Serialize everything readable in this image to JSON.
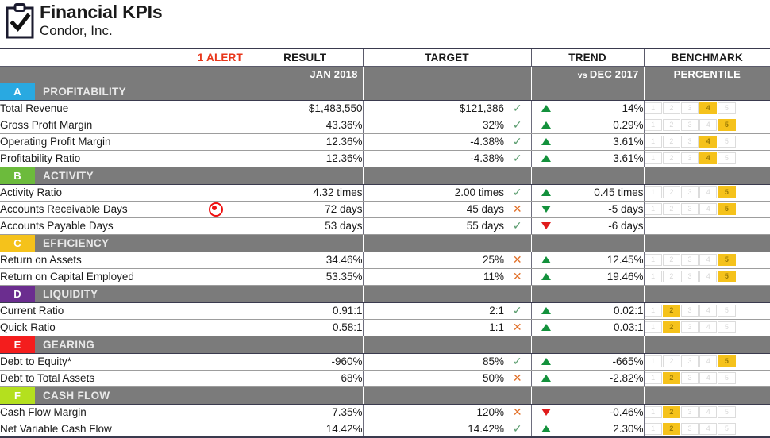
{
  "header": {
    "icon": "clipboard-check-icon",
    "title": "Financial KPIs",
    "subtitle": "Condor, Inc."
  },
  "columns": {
    "name": "",
    "alert": "1 ALERT",
    "result": "RESULT",
    "target": "TARGET",
    "trend": "TREND",
    "benchmark": "BENCHMARK"
  },
  "period": {
    "result": "JAN 2018",
    "target": "",
    "trend_prefix": "vs",
    "trend": "DEC 2017",
    "benchmark": "PERCENTILE"
  },
  "colors": {
    "alert_text": "#e8361a",
    "band": "#7b7b7b",
    "up_arrow": "#13913c",
    "down_arrow_bad": "#e01b1b",
    "check": "#5a9c6e",
    "cross": "#e2712a",
    "percentile_fill": "#f5c21b",
    "section_a": "#29a9e1",
    "section_b": "#6cbb3c",
    "section_c": "#f5c21b",
    "section_d": "#6b2d8f",
    "section_e": "#f41d1d",
    "section_f": "#b4e01e"
  },
  "sections": [
    {
      "letter": "A",
      "name": "PROFITABILITY",
      "color": "#29a9e1",
      "rows": [
        {
          "name": "Total Revenue",
          "alert": false,
          "result": "$1,483,550",
          "target": "$121,386",
          "target_status": "check",
          "trend_dir": "up",
          "trend_color": "green",
          "trend": "14%",
          "percentile": 4
        },
        {
          "name": "Gross Profit Margin",
          "alert": false,
          "result": "43.36%",
          "target": "32%",
          "target_status": "check",
          "trend_dir": "up",
          "trend_color": "green",
          "trend": "0.29%",
          "percentile": 5
        },
        {
          "name": "Operating Profit Margin",
          "alert": false,
          "result": "12.36%",
          "target": "-4.38%",
          "target_status": "check",
          "trend_dir": "up",
          "trend_color": "green",
          "trend": "3.61%",
          "percentile": 4
        },
        {
          "name": "Profitability Ratio",
          "alert": false,
          "result": "12.36%",
          "target": "-4.38%",
          "target_status": "check",
          "trend_dir": "up",
          "trend_color": "green",
          "trend": "3.61%",
          "percentile": 4
        }
      ]
    },
    {
      "letter": "B",
      "name": "ACTIVITY",
      "color": "#6cbb3c",
      "rows": [
        {
          "name": "Activity Ratio",
          "alert": false,
          "result": "4.32 times",
          "target": "2.00 times",
          "target_status": "check",
          "trend_dir": "up",
          "trend_color": "green",
          "trend": "0.45 times",
          "percentile": 5
        },
        {
          "name": "Accounts Receivable Days",
          "alert": true,
          "result": "72 days",
          "target": "45 days",
          "target_status": "cross",
          "trend_dir": "down",
          "trend_color": "green",
          "trend": "-5 days",
          "percentile": 5
        },
        {
          "name": "Accounts Payable Days",
          "alert": false,
          "result": "53 days",
          "target": "55 days",
          "target_status": "check",
          "trend_dir": "down",
          "trend_color": "red",
          "trend": "-6 days",
          "percentile": 0
        }
      ]
    },
    {
      "letter": "C",
      "name": "EFFICIENCY",
      "color": "#f5c21b",
      "rows": [
        {
          "name": "Return on Assets",
          "alert": false,
          "result": "34.46%",
          "target": "25%",
          "target_status": "cross",
          "trend_dir": "up",
          "trend_color": "green",
          "trend": "12.45%",
          "percentile": 5
        },
        {
          "name": "Return on Capital Employed",
          "alert": false,
          "result": "53.35%",
          "target": "11%",
          "target_status": "cross",
          "trend_dir": "up",
          "trend_color": "green",
          "trend": "19.46%",
          "percentile": 5
        }
      ]
    },
    {
      "letter": "D",
      "name": "LIQUIDITY",
      "color": "#6b2d8f",
      "rows": [
        {
          "name": "Current Ratio",
          "alert": false,
          "result": "0.91:1",
          "target": "2:1",
          "target_status": "check",
          "trend_dir": "up",
          "trend_color": "green",
          "trend": "0.02:1",
          "percentile": 2
        },
        {
          "name": "Quick Ratio",
          "alert": false,
          "result": "0.58:1",
          "target": "1:1",
          "target_status": "cross",
          "trend_dir": "up",
          "trend_color": "green",
          "trend": "0.03:1",
          "percentile": 2
        }
      ]
    },
    {
      "letter": "E",
      "name": "GEARING",
      "color": "#f41d1d",
      "rows": [
        {
          "name": "Debt to Equity*",
          "alert": false,
          "result": "-960%",
          "target": "85%",
          "target_status": "check",
          "trend_dir": "up",
          "trend_color": "green",
          "trend": "-665%",
          "percentile": 5
        },
        {
          "name": "Debt to Total Assets",
          "alert": false,
          "result": "68%",
          "target": "50%",
          "target_status": "cross",
          "trend_dir": "up",
          "trend_color": "green",
          "trend": "-2.82%",
          "percentile": 2
        }
      ]
    },
    {
      "letter": "F",
      "name": "CASH FLOW",
      "color": "#b4e01e",
      "rows": [
        {
          "name": "Cash Flow Margin",
          "alert": false,
          "result": "7.35%",
          "target": "120%",
          "target_status": "cross",
          "trend_dir": "down",
          "trend_color": "red",
          "trend": "-0.46%",
          "percentile": 2
        },
        {
          "name": "Net Variable Cash Flow",
          "alert": false,
          "result": "14.42%",
          "target": "14.42%",
          "target_status": "check",
          "trend_dir": "up",
          "trend_color": "green",
          "trend": "2.30%",
          "percentile": 2
        }
      ]
    }
  ],
  "percentile_labels": [
    "1",
    "2",
    "3",
    "4",
    "5"
  ]
}
